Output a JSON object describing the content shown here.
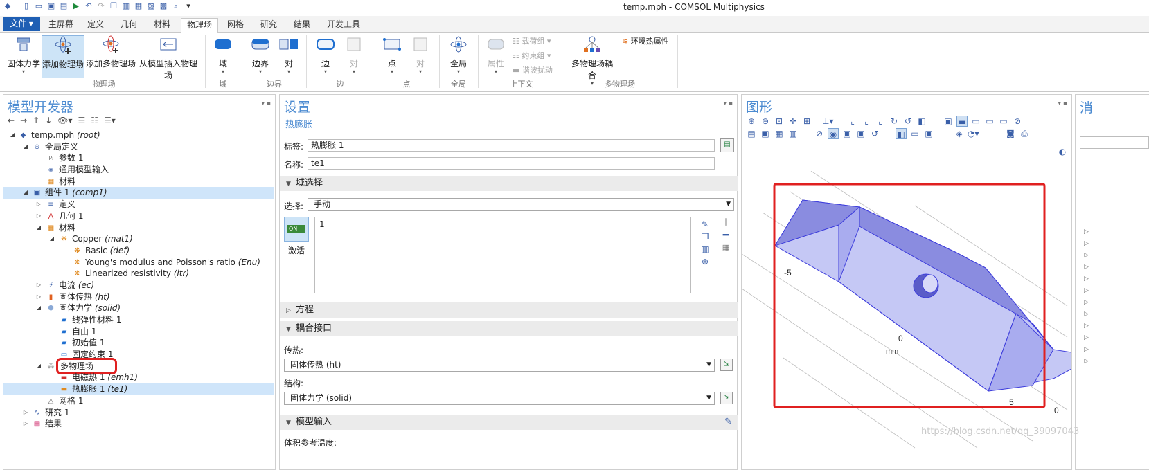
{
  "window": {
    "title": "temp.mph - COMSOL Multiphysics"
  },
  "ribbon": {
    "file_tab": "文件 ▾",
    "tabs": [
      "主屏幕",
      "定义",
      "几何",
      "材料",
      "物理场",
      "网格",
      "研究",
      "结果",
      "开发工具"
    ],
    "active_tab": "物理场",
    "buttons": {
      "solid_mech": "固体力学",
      "add_physics": "添加物理场",
      "add_multiphysics": "添加多物理场",
      "insert_from_model": "从模型插入物理场",
      "domain": "域",
      "boundary": "边界",
      "pair_b": "对",
      "edge": "边",
      "pair_e": "对",
      "point": "点",
      "pair_p": "对",
      "global": "全局",
      "property": "属性",
      "load_group": "载荷组 ▾",
      "constraint_group": "约束组 ▾",
      "harmonic_perturbation": "谐波扰动",
      "multiphysics_coupling": "多物理场耦合",
      "ambient_thermal": "环境热属性"
    },
    "groups": {
      "physics": "物理场",
      "domain": "域",
      "boundary": "边界",
      "edge": "边",
      "point": "点",
      "global": "全局",
      "context": "上下文",
      "multiphysics": "多物理场"
    }
  },
  "model_builder": {
    "title": "模型开发器",
    "nodes": [
      {
        "label": "temp.mph",
        "tag": "(root)"
      },
      {
        "label": "全局定义",
        "tag": ""
      },
      {
        "label": "参数 1",
        "tag": ""
      },
      {
        "label": "通用模型输入",
        "tag": ""
      },
      {
        "label": "材料",
        "tag": ""
      },
      {
        "label": "组件 1",
        "tag": "(comp1)"
      },
      {
        "label": "定义",
        "tag": ""
      },
      {
        "label": "几何 1",
        "tag": ""
      },
      {
        "label": "材料",
        "tag": ""
      },
      {
        "label": "Copper",
        "tag": "(mat1)"
      },
      {
        "label": "Basic",
        "tag": "(def)"
      },
      {
        "label": "Young's modulus and Poisson's ratio",
        "tag": "(Enu)"
      },
      {
        "label": "Linearized resistivity",
        "tag": "(ltr)"
      },
      {
        "label": "电流",
        "tag": "(ec)"
      },
      {
        "label": "固体传热",
        "tag": "(ht)"
      },
      {
        "label": "固体力学",
        "tag": "(solid)"
      },
      {
        "label": "线弹性材料 1",
        "tag": ""
      },
      {
        "label": "自由 1",
        "tag": ""
      },
      {
        "label": "初始值 1",
        "tag": ""
      },
      {
        "label": "固定约束 1",
        "tag": ""
      },
      {
        "label": "多物理场",
        "tag": ""
      },
      {
        "label": "电磁热 1",
        "tag": "(emh1)"
      },
      {
        "label": "热膨胀 1",
        "tag": "(te1)"
      },
      {
        "label": "网格 1",
        "tag": ""
      },
      {
        "label": "研究 1",
        "tag": ""
      },
      {
        "label": "结果",
        "tag": ""
      }
    ]
  },
  "settings": {
    "title": "设置",
    "subtitle": "热膨胀",
    "label_label": "标签:",
    "label_value": "热膨胀 1",
    "name_label": "名称:",
    "name_value": "te1",
    "sec_domain": "域选择",
    "selection_label": "选择:",
    "selection_value": "手动",
    "selection_list_item": "1",
    "active_label": "激活",
    "toggle_on": "ON",
    "sec_equation": "方程",
    "sec_coupled": "耦合接口",
    "heat_label": "传热:",
    "heat_value": "固体传热 (ht)",
    "struct_label": "结构:",
    "struct_value": "固体力学 (solid)",
    "sec_model_input": "模型输入",
    "vol_ref_temp": "体积参考温度:"
  },
  "graphics": {
    "title": "图形",
    "axis_labels": {
      "left": "-5",
      "center": "0",
      "unit": "mm",
      "bottom": "5",
      "corner": "0"
    }
  },
  "watermark": "https://blog.csdn.net/qq_39097043",
  "colors": {
    "accent": "#4c8bd1",
    "body_fill": "#c5c8f5",
    "highlight": "#e02020"
  }
}
